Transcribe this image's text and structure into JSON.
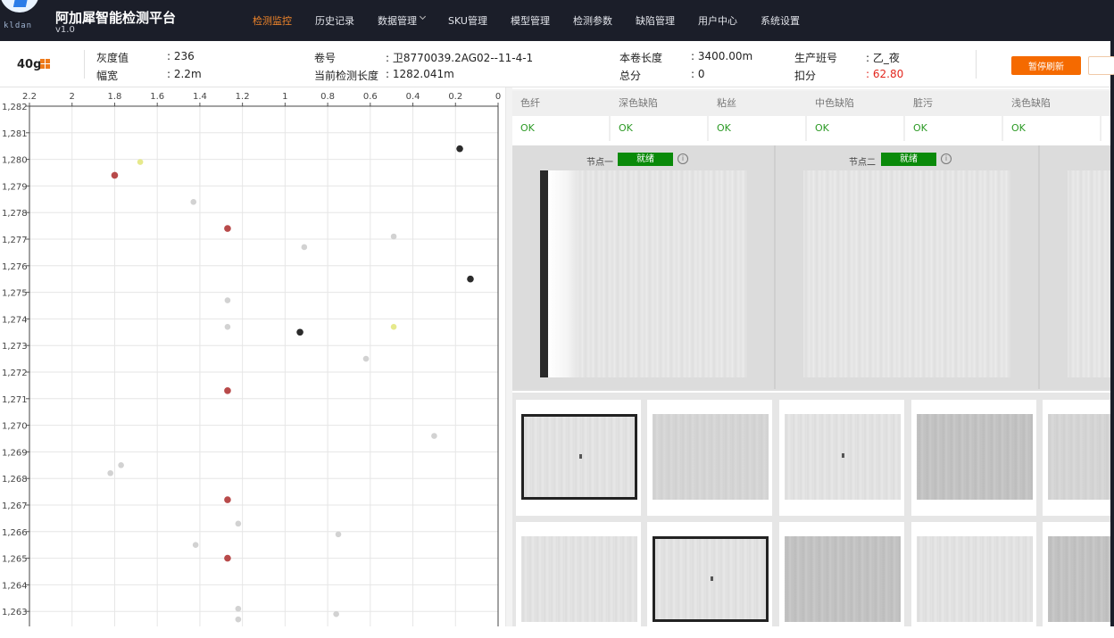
{
  "app": {
    "title": "阿加犀智能检测平台",
    "version": "v1.0",
    "logo_waves": "kldan"
  },
  "nav": {
    "items": [
      {
        "label": "检测监控",
        "active": true
      },
      {
        "label": "历史记录",
        "active": false
      },
      {
        "label": "数据管理",
        "active": false,
        "has_dropdown": true
      },
      {
        "label": "SKU管理",
        "active": false
      },
      {
        "label": "模型管理",
        "active": false
      },
      {
        "label": "检测参数",
        "active": false
      },
      {
        "label": "缺陷管理",
        "active": false
      },
      {
        "label": "用户中心",
        "active": false
      },
      {
        "label": "系统设置",
        "active": false
      }
    ]
  },
  "info": {
    "gram": "40g",
    "gray_label": "灰度值",
    "gray_value": ": 236",
    "width_label": "幅宽",
    "width_value": ": 2.2m",
    "roll_label": "卷号",
    "roll_value": ": 卫8770039.2AG02--11-4-1",
    "cur_len_label": "当前检测长度",
    "cur_len_value": ": 1282.041m",
    "roll_len_label": "本卷长度",
    "roll_len_value": ": 3400.00m",
    "total_label": "总分",
    "total_value": ": 0",
    "shift_label": "生产班号",
    "shift_value": ": 乙_夜",
    "deduct_label": "扣分",
    "deduct_value": ": 62.80",
    "pause_button": "暂停刷新"
  },
  "defect_table": {
    "headers": [
      "色纤",
      "深色缺陷",
      "粘丝",
      "中色缺陷",
      "脏污",
      "浅色缺陷"
    ],
    "values": [
      "OK",
      "OK",
      "OK",
      "OK",
      "OK",
      "OK"
    ]
  },
  "nodes": [
    {
      "label": "节点一",
      "status": "就绪"
    },
    {
      "label": "节点二",
      "status": "就绪"
    }
  ],
  "chart_data": {
    "type": "scatter",
    "x_axis": {
      "ticks": [
        "2.2",
        "2",
        "1.8",
        "1.6",
        "1.4",
        "1.2",
        "1",
        "0.8",
        "0.6",
        "0.4",
        "0.2",
        "0"
      ],
      "range": [
        2.2,
        0
      ],
      "reversed": true,
      "position": "top"
    },
    "y_axis": {
      "ticks": [
        "1,282",
        "1,281",
        "1,280",
        "1,279",
        "1,278",
        "1,277",
        "1,276",
        "1,275",
        "1,274",
        "1,273",
        "1,272",
        "1,271",
        "1,270",
        "1,269",
        "1,268",
        "1,267",
        "1,266",
        "1,265",
        "1,264",
        "1,263"
      ],
      "range": [
        1282,
        1262.7
      ]
    },
    "grid": true,
    "colors": {
      "red": "#b84a4a",
      "black": "#2b2b2b",
      "yellow": "#e6e98c",
      "gray": "#d2d2d2"
    },
    "points": [
      {
        "x": 0.18,
        "y": 1280.4,
        "c": "black"
      },
      {
        "x": 1.68,
        "y": 1279.9,
        "c": "yellow"
      },
      {
        "x": 1.8,
        "y": 1279.4,
        "c": "red"
      },
      {
        "x": 1.43,
        "y": 1278.4,
        "c": "gray"
      },
      {
        "x": 1.27,
        "y": 1277.4,
        "c": "red"
      },
      {
        "x": 0.49,
        "y": 1277.1,
        "c": "gray"
      },
      {
        "x": 0.91,
        "y": 1276.7,
        "c": "gray"
      },
      {
        "x": 0.13,
        "y": 1275.5,
        "c": "black"
      },
      {
        "x": 1.27,
        "y": 1274.7,
        "c": "gray"
      },
      {
        "x": 1.27,
        "y": 1273.7,
        "c": "gray"
      },
      {
        "x": 0.49,
        "y": 1273.7,
        "c": "yellow"
      },
      {
        "x": 0.93,
        "y": 1273.5,
        "c": "black"
      },
      {
        "x": 0.62,
        "y": 1272.5,
        "c": "gray"
      },
      {
        "x": 1.27,
        "y": 1271.3,
        "c": "red"
      },
      {
        "x": 0.3,
        "y": 1269.6,
        "c": "gray"
      },
      {
        "x": 1.77,
        "y": 1268.5,
        "c": "gray"
      },
      {
        "x": 1.82,
        "y": 1268.2,
        "c": "gray"
      },
      {
        "x": 1.27,
        "y": 1267.2,
        "c": "red"
      },
      {
        "x": 1.22,
        "y": 1266.3,
        "c": "gray"
      },
      {
        "x": 0.75,
        "y": 1265.9,
        "c": "gray"
      },
      {
        "x": 1.42,
        "y": 1265.5,
        "c": "gray"
      },
      {
        "x": 1.27,
        "y": 1265.0,
        "c": "red"
      },
      {
        "x": 1.22,
        "y": 1263.1,
        "c": "gray"
      },
      {
        "x": 0.76,
        "y": 1262.9,
        "c": "gray"
      },
      {
        "x": 1.22,
        "y": 1262.7,
        "c": "gray"
      }
    ]
  }
}
